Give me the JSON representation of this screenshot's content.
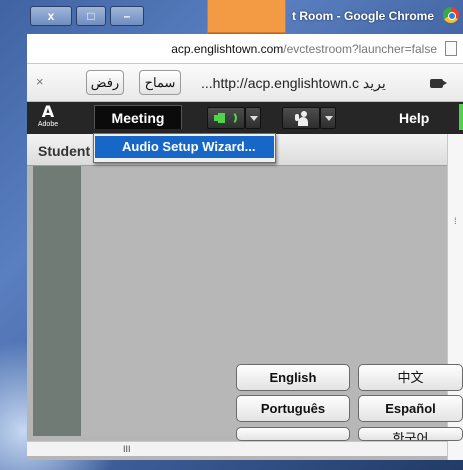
{
  "window": {
    "title": "t Room - Google Chrome",
    "caption_buttons": [
      "x",
      "□",
      "–"
    ]
  },
  "address_bar": {
    "host": "acp.englishtown.com",
    "path": "/evctestroom?launcher=false"
  },
  "infobar": {
    "close_glyph": "×",
    "deny_label": "رفض",
    "allow_label": "سماح",
    "message": "...http://acp.englishtown.c يريد"
  },
  "toolbar": {
    "logo_text": "Adobe",
    "meeting_label": "Meeting",
    "help_label": "Help",
    "accent_green": "#4fd34a"
  },
  "dropdown": {
    "items": [
      {
        "label": "Audio Setup Wizard...",
        "highlighted": true
      }
    ],
    "highlight_color": "#1767c8"
  },
  "pod": {
    "title": "Student"
  },
  "languages": [
    "English",
    "中文",
    "Português",
    "Español",
    "",
    "한국어"
  ],
  "scrollbar": {
    "grip": "III"
  },
  "colors": {
    "orange_block": "#f39a45",
    "toolbar_bg": "#262626"
  }
}
